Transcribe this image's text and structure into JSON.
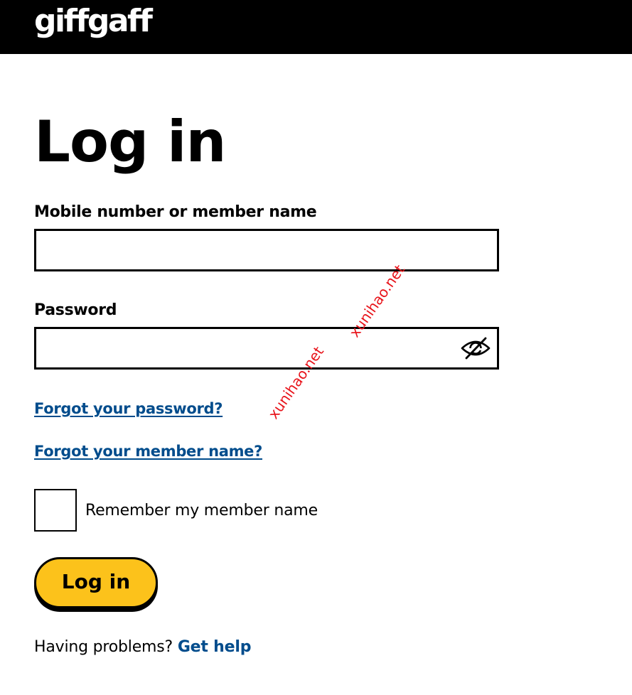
{
  "header": {
    "logo_text": "giffgaff",
    "background_color": "#000000"
  },
  "page": {
    "title": "Log in"
  },
  "form": {
    "mobile_label": "Mobile number or member name",
    "mobile_value": "",
    "password_label": "Password",
    "password_value": "",
    "password_toggle_icon": "eye-slash-icon",
    "forgot_password_link": "Forgot your password?",
    "forgot_member_link": "Forgot your member name?",
    "remember_label": "Remember my member name",
    "remember_checked": false,
    "login_button_label": "Log in"
  },
  "footer": {
    "help_prompt": "Having problems?",
    "help_link": "Get help"
  },
  "watermarks": [
    "xunihao.net",
    "xunihao.net"
  ],
  "colors": {
    "accent_yellow": "#fcc21b",
    "link_blue": "#004c8c",
    "watermark_red": "#e8141b"
  }
}
